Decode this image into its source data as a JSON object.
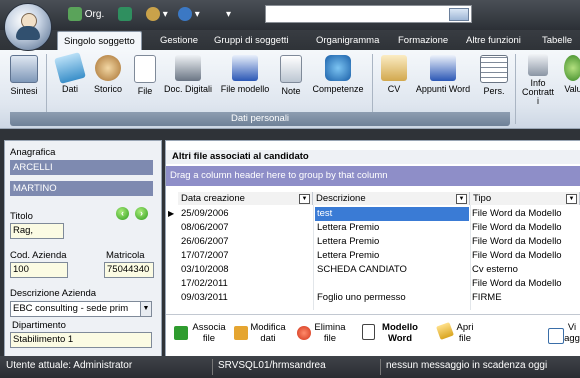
{
  "titlebar": {
    "qat_org_label": "Org.",
    "qat_arrow": "▾"
  },
  "tabs": [
    "Singolo soggetto",
    "Gestione",
    "Gruppi di soggetti",
    "Organigramma",
    "Formazione",
    "Altre funzioni",
    "Tabelle"
  ],
  "ribbon": {
    "buttons": [
      "Sintesi",
      "Dati",
      "Storico",
      "File",
      "Doc. Digitali",
      "File modello",
      "Note",
      "Competenze",
      "CV",
      "Appunti Word",
      "Pers."
    ],
    "extra1": [
      "Info",
      "Contratt",
      "i"
    ],
    "extra2": "Valu",
    "group_label": "Dati personali"
  },
  "left_panel": {
    "anagrafica_label": "Anagrafica",
    "cognome": "ARCELLI",
    "nome": "MARTINO",
    "titolo_label": "Titolo",
    "titolo_value": "Rag,",
    "cod_azienda_label": "Cod. Azienda",
    "cod_azienda_value": "100",
    "matricola_label": "Matricola",
    "matricola_value": "75044340",
    "descrizione_azienda_label": "Descrizione Azienda",
    "descrizione_azienda_value": "EBC consulting - sede prim",
    "dipartimento_label": "Dipartimento",
    "dipartimento_value": "Stabilimento 1"
  },
  "grid": {
    "title": "Altri file associati al candidato",
    "group_hint": "Drag a column header here to group by that column",
    "columns": [
      "Data creazione",
      "Descrizione",
      "Tipo"
    ],
    "rows": [
      [
        "25/09/2006",
        "test",
        "File Word da Modello"
      ],
      [
        "08/06/2007",
        "Lettera Premio",
        "File Word da Modello"
      ],
      [
        "26/06/2007",
        "Lettera Premio",
        "File Word da Modello"
      ],
      [
        "17/07/2007",
        "Lettera Premio",
        "File Word da Modello"
      ],
      [
        "03/10/2008",
        "SCHEDA CANDIATO",
        "Cv esterno"
      ],
      [
        "17/02/2011",
        "",
        "File Word da Modello"
      ],
      [
        "09/03/2011",
        "Foglio uno permesso",
        "FIRME"
      ]
    ]
  },
  "bottom_toolbar": [
    [
      "Associa",
      "file"
    ],
    [
      "Modifica",
      "dati"
    ],
    [
      "Elimina",
      "file"
    ],
    [
      "Modello",
      "Word"
    ],
    [
      "Apri",
      "file"
    ],
    [
      "Vi",
      "agg"
    ]
  ],
  "status": {
    "user": "Utente attuale: Administrator",
    "server": "SRVSQL01/hrmsandrea",
    "messages": "nessun messaggio in scadenza oggi"
  }
}
